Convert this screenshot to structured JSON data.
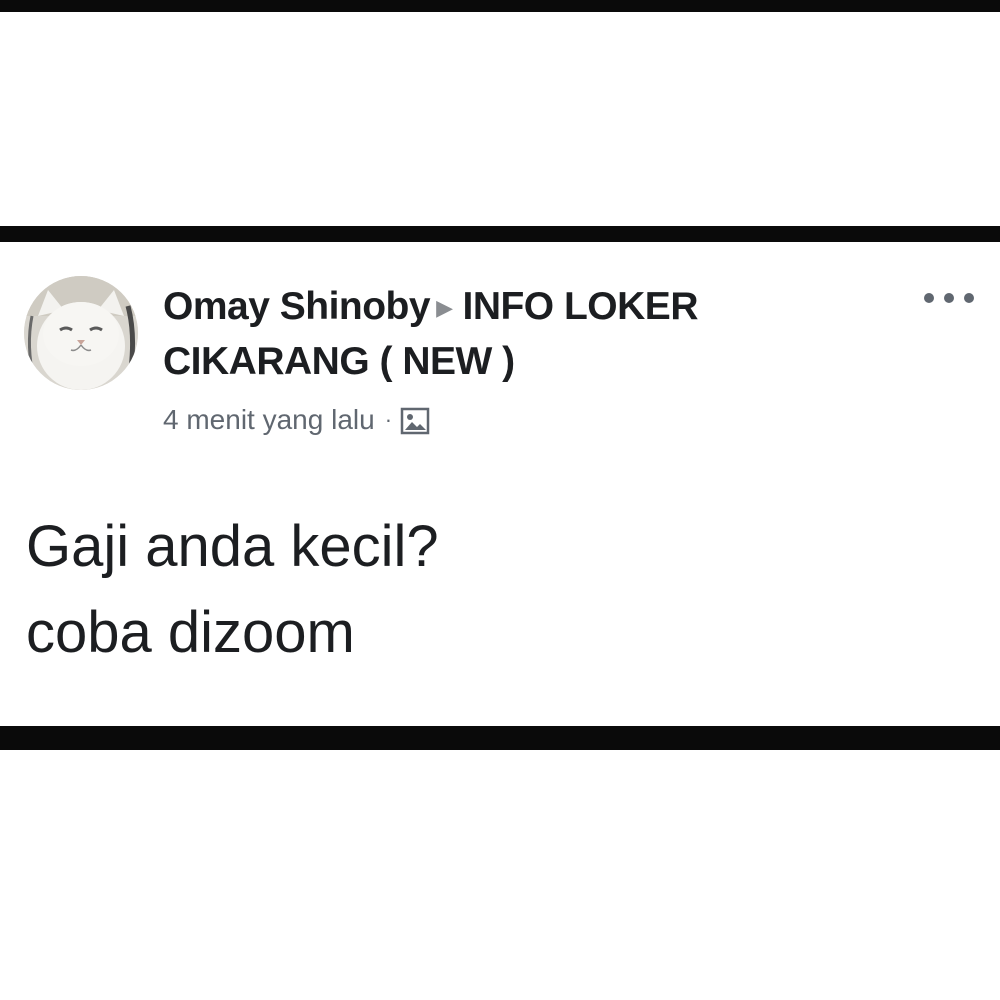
{
  "post": {
    "author": "Omay Shinoby",
    "group": "INFO LOKER CIKARANG ( NEW )",
    "timestamp": "4 menit yang lalu",
    "separator": "·",
    "arrow": "▶",
    "audience_icon": "photo-audience-icon",
    "menu_icon": "more-options-icon",
    "body_lines": [
      "Gaji anda kecil?",
      "coba dizoom"
    ]
  },
  "colors": {
    "bars": "#0a0a0a",
    "text": "#1c1e21",
    "meta": "#606770"
  }
}
